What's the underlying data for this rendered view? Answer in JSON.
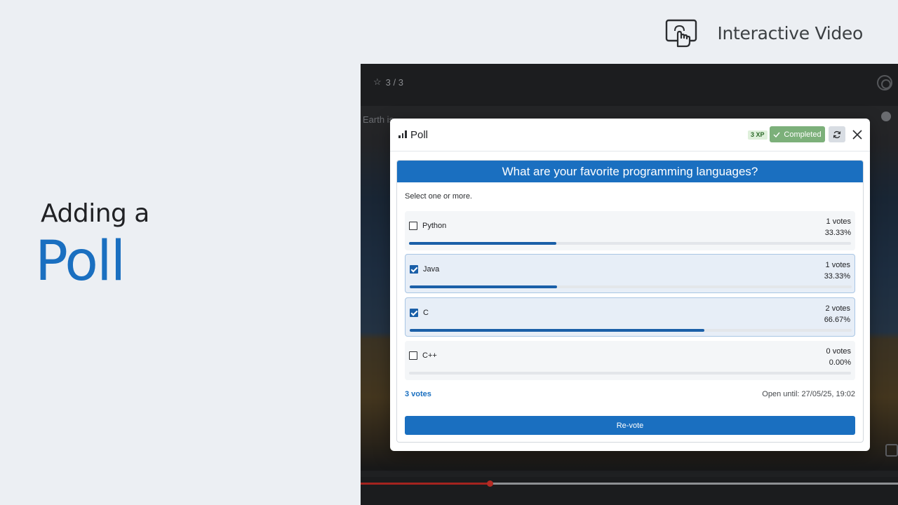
{
  "brand": {
    "icon": "touch-screen-icon",
    "text": "Interactive Video"
  },
  "headline": {
    "line1": "Adding a",
    "line2": "Poll"
  },
  "player": {
    "star_count": "3 / 3",
    "caption": "Earth is …"
  },
  "modal": {
    "title": "Poll",
    "xp": "3 XP",
    "completed_label": "Completed",
    "question": "What are your favorite programming languages?",
    "hint": "Select one or more.",
    "options": [
      {
        "label": "Python",
        "votes": "1 votes",
        "percent": "33.33%",
        "checked": false,
        "fraction": 0.3333
      },
      {
        "label": "Java",
        "votes": "1 votes",
        "percent": "33.33%",
        "checked": true,
        "fraction": 0.3333
      },
      {
        "label": "C",
        "votes": "2 votes",
        "percent": "66.67%",
        "checked": true,
        "fraction": 0.6667
      },
      {
        "label": "C++",
        "votes": "0 votes",
        "percent": "0.00%",
        "checked": false,
        "fraction": 0
      }
    ],
    "total_votes": "3 votes",
    "open_until": "Open until: 27/05/25, 19:02",
    "revote_label": "Re-vote"
  },
  "colors": {
    "accent": "#1a6fc0",
    "completed": "#7cb07a",
    "progress": "#a4231f"
  },
  "progress": 0.24
}
